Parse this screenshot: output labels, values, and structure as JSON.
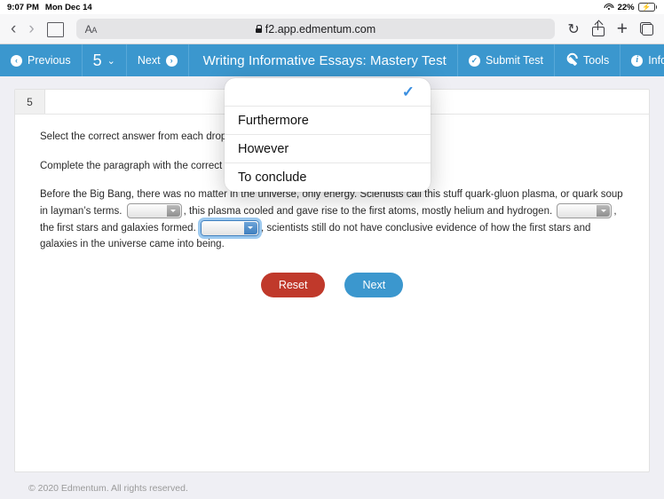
{
  "status_bar": {
    "time": "9:07 PM",
    "date": "Mon Dec 14",
    "charging_bolt": "⚡",
    "wifi_icon": "wifi-icon",
    "battery_percent": "22%",
    "battery_level": 22
  },
  "browser": {
    "back_icon": "‹",
    "forward_icon": "›",
    "bookmarks_icon": "book-icon",
    "text_size_label": "A",
    "text_size_label_small": "A",
    "lock_icon": "lock-icon",
    "url": "f2.app.edmentum.com",
    "reload_icon": "↻",
    "share_icon": "share-icon",
    "newtab_icon": "+",
    "tabs_icon": "tabs-icon"
  },
  "appbar": {
    "previous_label": "Previous",
    "question_number": "5",
    "chevron": "⌄",
    "next_label": "Next",
    "title": "Writing Informative Essays: Mastery Test",
    "submit_label": "Submit Test",
    "tools_label": "Tools",
    "info_label": "Info",
    "submit_icon": "✓",
    "info_icon": "i",
    "prev_icon": "‹",
    "next_icon": "›",
    "accent_color": "#3b97ce"
  },
  "question": {
    "tab_label": "5",
    "instruction": "Select the correct answer from each drop-down menu.",
    "prompt": "Complete the paragraph with the correct transition words.",
    "paragraph": {
      "seg1": "Before the Big Bang, there was no matter in the universe, only energy",
      "seg2": ". Scientists call this stuff quark-gluon plasma, or quark soup in layman’s terms.",
      "seg3": ", this plasma cooled and gave rise to the first atoms, mostly helium and hydrogen.",
      "seg4": ", the first stars and galaxies formed.",
      "seg5": ", scientists still do not have conclusive evidence of how the first stars and galaxies in the universe came into being."
    },
    "dropdown1_value": "",
    "dropdown2_value": "",
    "dropdown3_value": "",
    "reset_label": "Reset",
    "next_label": "Next",
    "reset_color": "#c0392b",
    "next_color": "#3b97ce"
  },
  "select_popover": {
    "options": [
      {
        "label": "",
        "selected": true,
        "check_icon": "✓"
      },
      {
        "label": "Furthermore",
        "selected": false
      },
      {
        "label": "However",
        "selected": false
      },
      {
        "label": "To conclude",
        "selected": false
      }
    ],
    "check_color": "#3b8fe0"
  },
  "footer": {
    "copyright": "© 2020 Edmentum. All rights reserved."
  }
}
